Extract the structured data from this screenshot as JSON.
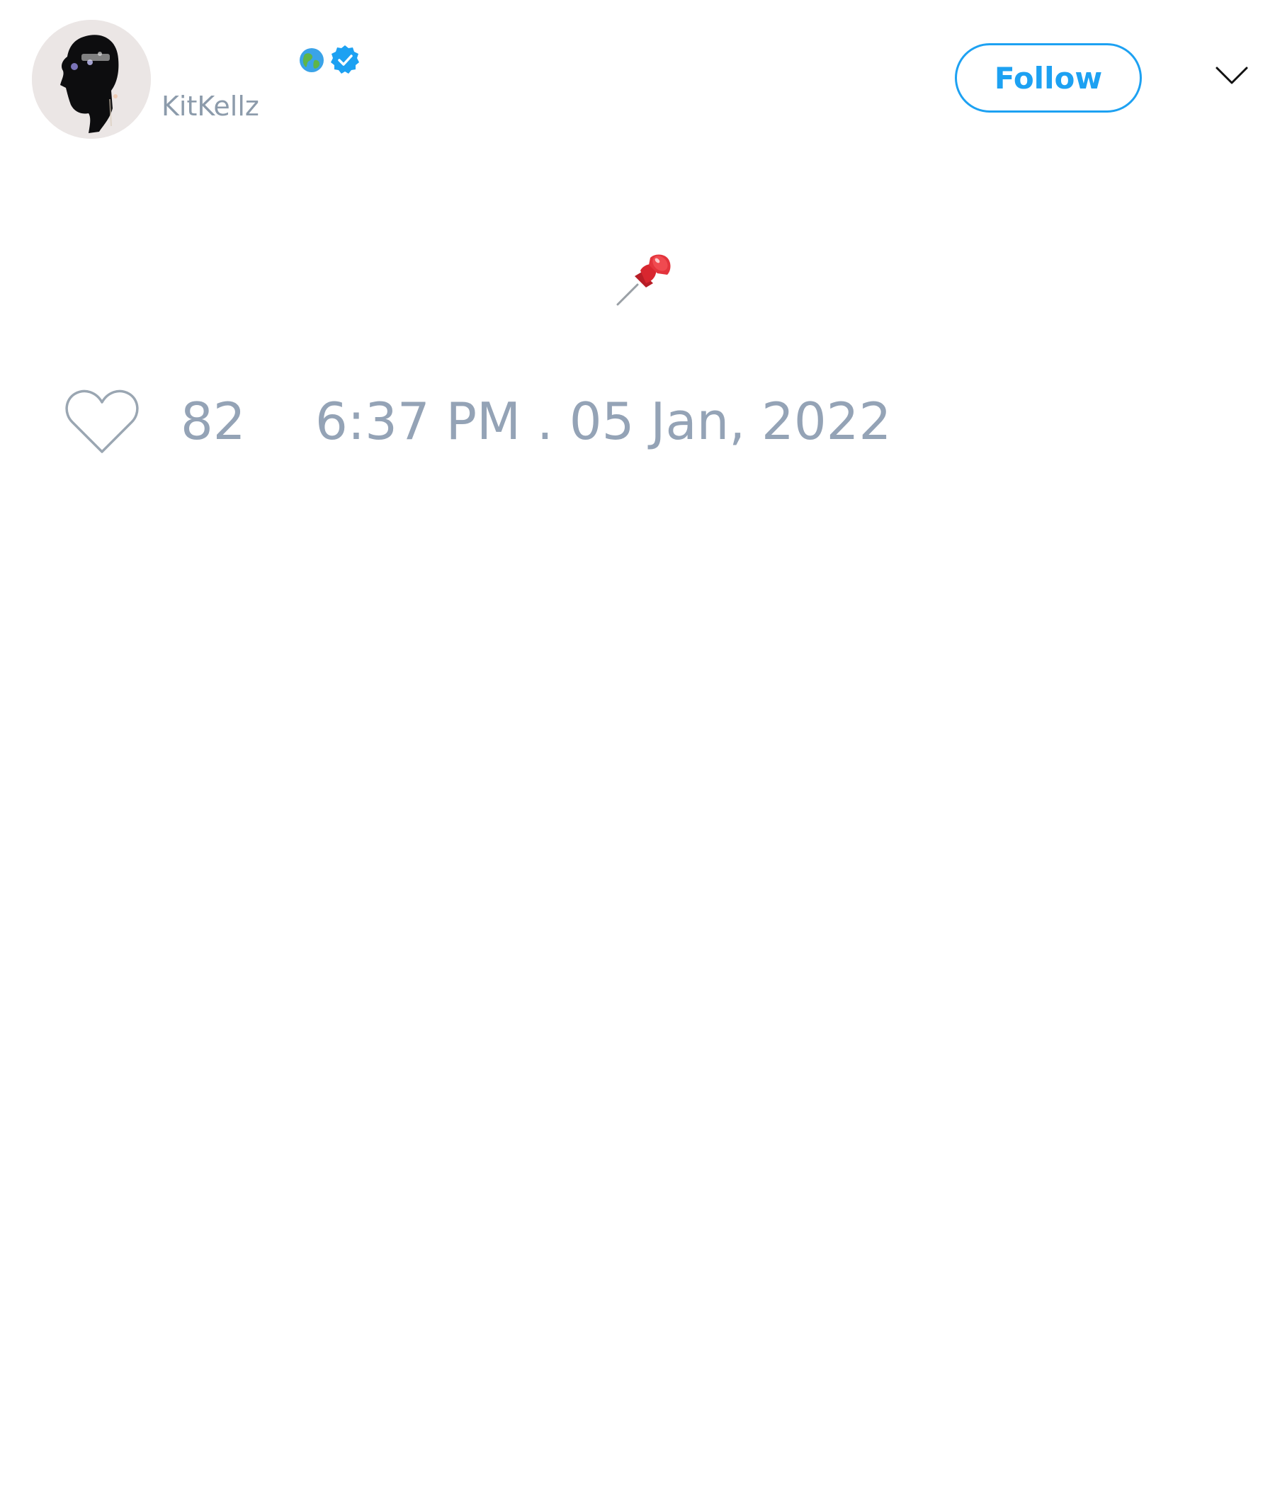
{
  "tweet": {
    "author": {
      "handle": "KitKellz",
      "avatar_icon": "profile-photo",
      "badges": [
        "globe-icon",
        "verified-badge-icon"
      ]
    },
    "header": {
      "follow_label": "Follow",
      "menu_icon": "chevron-down-icon"
    },
    "body": {
      "content_icon": "pushpin-emoji"
    },
    "footer": {
      "like_icon": "heart-outline-icon",
      "like_count": "82",
      "timestamp": "6:37 PM . 05 Jan, 2022"
    }
  },
  "colors": {
    "accent": "#1da1f2",
    "muted_text": "#94a3b6",
    "handle_text": "#8c9bab",
    "background": "#ffffff",
    "pin_red": "#d8262f"
  }
}
